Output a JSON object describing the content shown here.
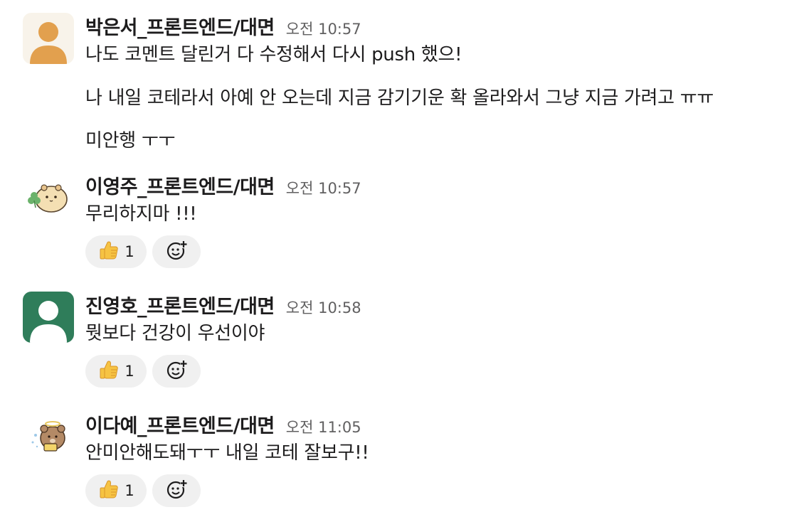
{
  "messages": [
    {
      "author": "박은서_프론트엔드/대면",
      "time": "오전 10:57",
      "avatar": "default-user-avatar",
      "avatar_bg": "#f8f3ea",
      "avatar_fg": "#e2a04e",
      "lines": [
        "나도 코멘트 달린거 다 수정해서 다시 push 했으!",
        "나 내일 코테라서 아예 안 오는데 지금 감기기운 확 올라와서 그냥 지금 가려고 ㅠㅠ",
        "미안행 ㅜㅜ"
      ]
    },
    {
      "author": "이영주_프론트엔드/대면",
      "time": "오전 10:57",
      "avatar": "hamster-clover-avatar",
      "lines": [
        "무리하지마 !!!"
      ],
      "reaction": {
        "emoji": "thumbs-up-icon",
        "count": "1"
      }
    },
    {
      "author": "진영호_프론트엔드/대면",
      "time": "오전 10:58",
      "avatar": "default-user-avatar",
      "avatar_bg": "#2f7d5a",
      "avatar_fg": "#ffffff",
      "lines": [
        "뭣보다 건강이 우선이야"
      ],
      "reaction": {
        "emoji": "thumbs-up-icon",
        "count": "1"
      }
    },
    {
      "author": "이다예_프론트엔드/대면",
      "time": "오전 11:05",
      "avatar": "bear-angel-avatar",
      "lines": [
        "안미안해도돼ㅜㅜ 내일 코테 잘보구!!"
      ],
      "reaction": {
        "emoji": "thumbs-up-icon",
        "count": "1"
      }
    }
  ],
  "add_reaction_icon": "add-emoji-icon"
}
